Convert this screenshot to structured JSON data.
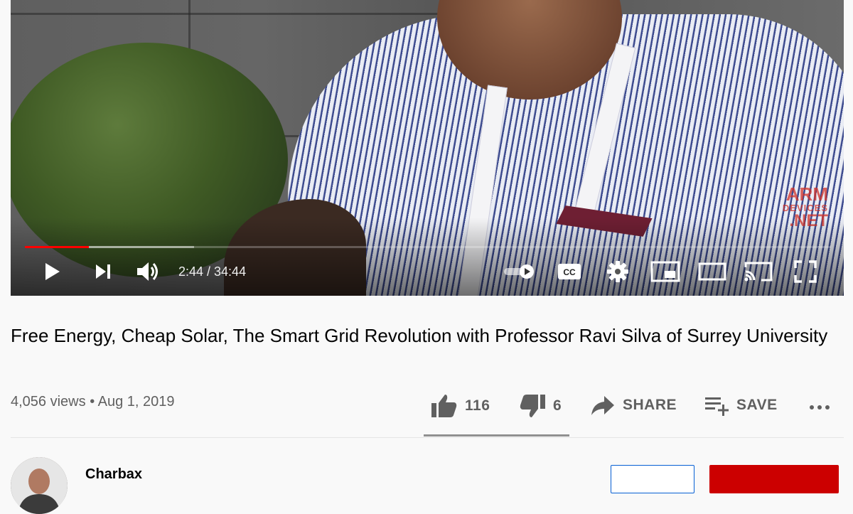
{
  "player": {
    "current_time": "2:44",
    "duration": "34:44",
    "time_display": "2:44 / 34:44",
    "progress_fraction": 0.079,
    "buffered_fraction": 0.21,
    "watermark": {
      "line1": "ARM",
      "line2": "DEVICES",
      "line3": ".NET"
    },
    "icons": [
      "play-icon",
      "next-icon",
      "volume-icon",
      "autoplay-toggle-icon",
      "cc-icon",
      "settings-icon",
      "miniplayer-icon",
      "theater-icon",
      "cast-icon",
      "fullscreen-icon"
    ]
  },
  "video": {
    "title": "Free Energy, Cheap Solar, The Smart Grid Revolution with Professor Ravi Silva of Surrey University",
    "views": "4,056 views",
    "separator": "•",
    "date": "Aug 1, 2019"
  },
  "actions": {
    "likes": "116",
    "dislikes": "6",
    "share_label": "SHARE",
    "save_label": "SAVE",
    "like_fraction": 0.95
  },
  "channel": {
    "name": "Charbax"
  },
  "colors": {
    "accent_red": "#ff0000",
    "subscribe_red": "#cc0000",
    "join_blue": "#065fd4",
    "meta_gray": "#606060"
  }
}
